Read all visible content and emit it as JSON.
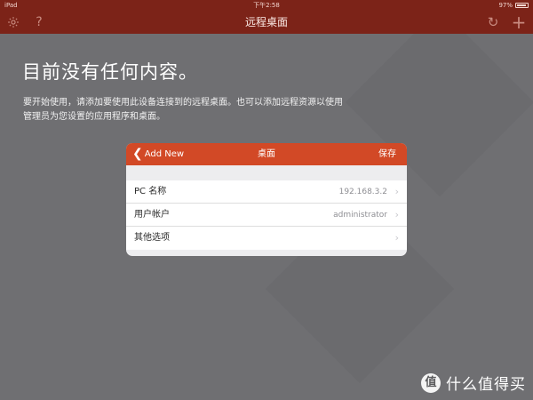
{
  "status_bar": {
    "device": "iPad",
    "time": "下午2:58",
    "battery": "97%"
  },
  "nav": {
    "title": "远程桌面",
    "icons": [
      "gear-icon",
      "help-icon",
      "refresh-icon",
      "plus-icon"
    ]
  },
  "empty_state": {
    "title": "目前没有任何内容。",
    "description": "要开始使用，请添加要使用此设备连接到的远程桌面。也可以添加远程资源以使用管理员为您设置的应用程序和桌面。"
  },
  "dialog": {
    "back_label": "Add New",
    "title": "桌面",
    "save_label": "保存",
    "rows": [
      {
        "label": "PC 名称",
        "value": "192.168.3.2"
      },
      {
        "label": "用户帐户",
        "value": "administrator"
      },
      {
        "label": "其他选项",
        "value": ""
      }
    ]
  },
  "watermark": {
    "logo": "值",
    "text": "什么值得买"
  },
  "colors": {
    "nav_bar": "#7c2318",
    "dialog_header": "#d24926",
    "background": "#6f6f72"
  }
}
